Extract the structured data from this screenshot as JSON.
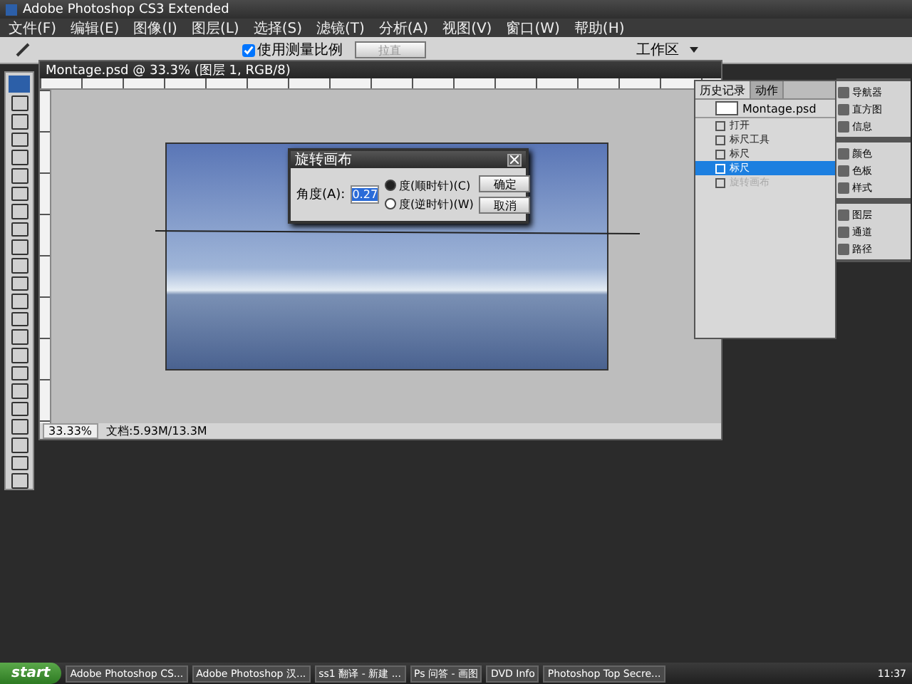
{
  "window": {
    "title": "Adobe Photoshop CS3 Extended"
  },
  "menu": [
    "文件(F)",
    "编辑(E)",
    "图像(I)",
    "图层(L)",
    "选择(S)",
    "滤镜(T)",
    "分析(A)",
    "视图(V)",
    "窗口(W)",
    "帮助(H)"
  ],
  "options_bar": {
    "checkbox": {
      "label": "使用测量比例",
      "checked": true
    },
    "button": "拉直",
    "workspace": "工作区"
  },
  "document": {
    "title": "Montage.psd @ 33.3% (图层 1, RGB/8)",
    "zoom": "33.33%",
    "doc_info": "文档:5.93M/13.3M"
  },
  "dialog": {
    "title": "旋转画布",
    "angle_label": "角度(A):",
    "angle_value": "0.27",
    "options": [
      {
        "label": "度(顺时针)(C)",
        "selected": true
      },
      {
        "label": "度(逆时针)(W)",
        "selected": false
      }
    ],
    "buttons": [
      "确定",
      "取消"
    ]
  },
  "history_panel": {
    "tabs": [
      {
        "label": "历史记录",
        "selected": true
      },
      {
        "label": "动作",
        "selected": false
      }
    ],
    "snapshot": "Montage.psd",
    "items": [
      {
        "label": "打开",
        "selected": false,
        "disabled": false
      },
      {
        "label": "标尺工具",
        "selected": false,
        "disabled": false
      },
      {
        "label": "标尺",
        "selected": false,
        "disabled": false
      },
      {
        "label": "标尺",
        "selected": true,
        "disabled": false
      },
      {
        "label": "旋转画布",
        "selected": false,
        "disabled": true
      }
    ]
  },
  "dock": {
    "groups": [
      [
        "导航器",
        "直方图",
        "信息"
      ],
      [
        "颜色",
        "色板",
        "样式"
      ],
      [
        "图层",
        "通道",
        "路径"
      ]
    ]
  },
  "taskbar": {
    "start": "start",
    "tasks": [
      "Adobe Photoshop CS...",
      "Adobe Photoshop 汉...",
      "ss1 翻译 - 新建 ...",
      "Ps 问答 - 画图",
      "DVD Info",
      "Photoshop Top Secre..."
    ],
    "clock": "11:37"
  }
}
